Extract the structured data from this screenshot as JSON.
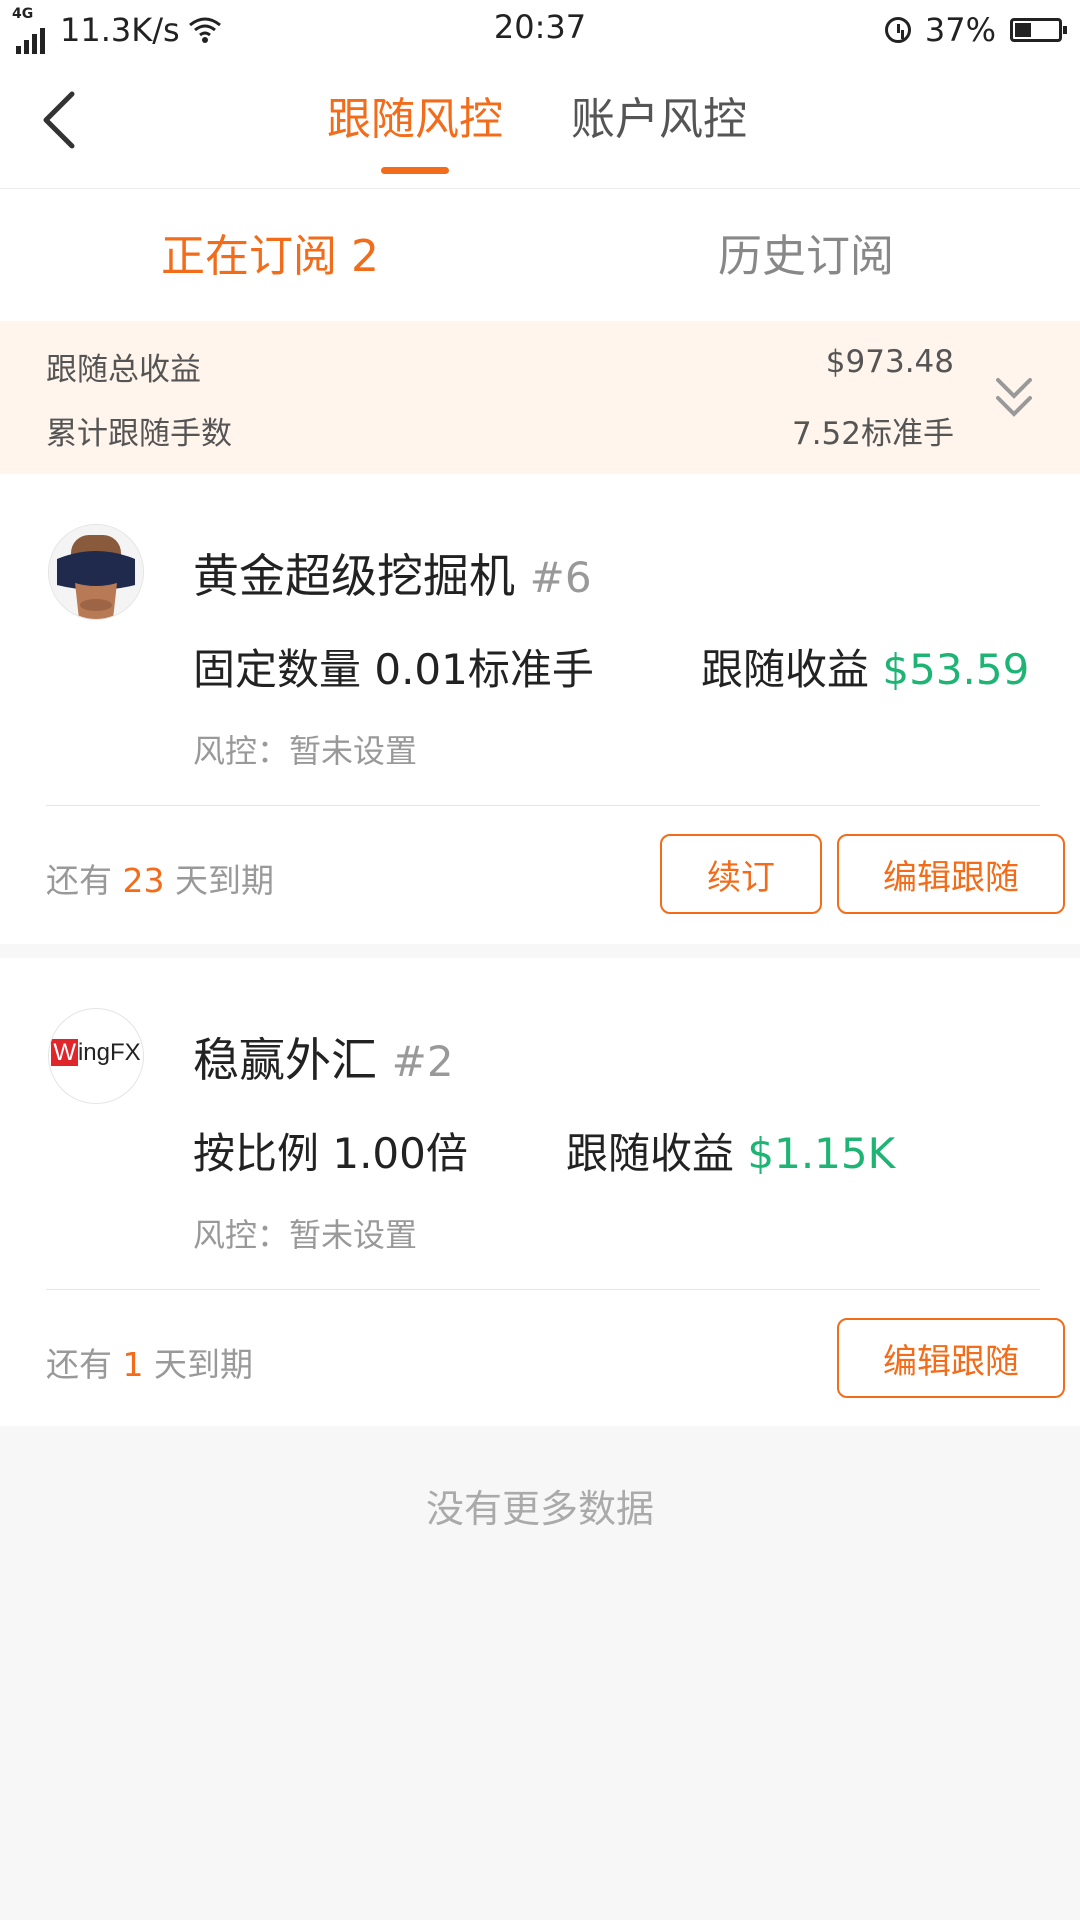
{
  "status_bar": {
    "network": "4G",
    "speed": "11.3K/s",
    "time": "20:37",
    "battery": "37%",
    "battery_level": 0.37
  },
  "nav": {
    "tabs": [
      {
        "label": "跟随风控",
        "active": true
      },
      {
        "label": "账户风控",
        "active": false
      }
    ]
  },
  "sub_tabs": [
    {
      "label": "正在订阅 2",
      "active": true
    },
    {
      "label": "历史订阅",
      "active": false
    }
  ],
  "summary": {
    "total_profit_label": "跟随总收益",
    "total_profit_value": "$973.48",
    "total_lots_label": "累计跟随手数",
    "total_lots_value": "7.52标准手"
  },
  "subscriptions": [
    {
      "name": "黄金超级挖掘机",
      "rank": "#6",
      "mode": "固定数量 0.01标准手",
      "profit_label": "跟随收益",
      "profit_value": "$53.59",
      "risk": "风控：暂未设置",
      "expiry_prefix": "还有",
      "expiry_days": "23",
      "expiry_suffix": "天到期",
      "renew_label": "续订",
      "edit_label": "编辑跟随"
    },
    {
      "name": "稳赢外汇",
      "rank": "#2",
      "avatar_text": "WingFX",
      "mode": "按比例 1.00倍",
      "profit_label": "跟随收益",
      "profit_value": "$1.15K",
      "risk": "风控：暂未设置",
      "expiry_prefix": "还有",
      "expiry_days": "1",
      "expiry_suffix": "天到期",
      "edit_label": "编辑跟随"
    }
  ],
  "footer": {
    "no_more": "没有更多数据"
  },
  "colors": {
    "accent": "#f26c1a",
    "profit": "#1db474",
    "summary_bg": "#fff5ec"
  },
  "icons": [
    "signal-icon",
    "wifi-icon",
    "alarm-icon",
    "battery-icon",
    "back-arrow-icon",
    "double-chevron-down-icon"
  ]
}
